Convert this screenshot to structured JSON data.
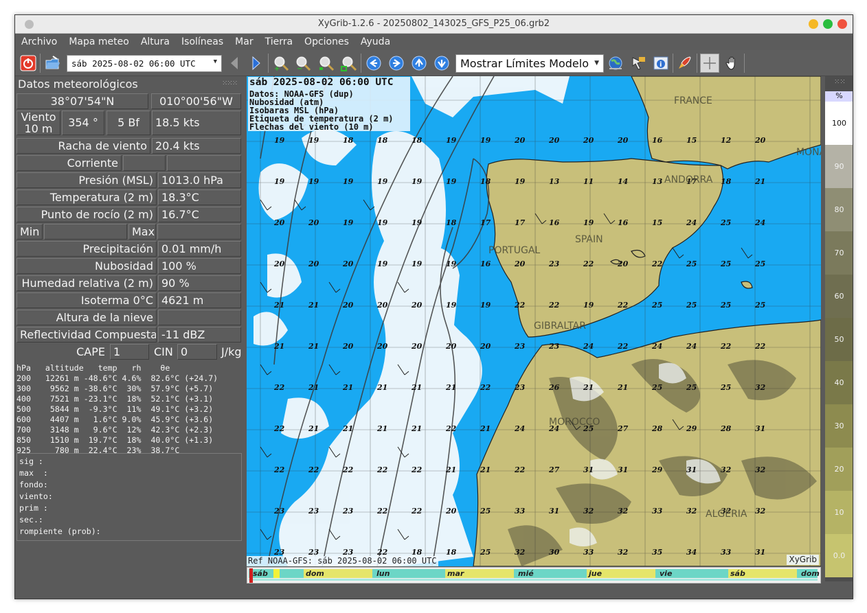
{
  "window": {
    "title": "XyGrib-1.2.6 - 20250802_143025_GFS_P25_06.grb2"
  },
  "menu": [
    "Archivo",
    "Mapa meteo",
    "Altura",
    "Isolíneas",
    "Mar",
    "Tierra",
    "Opciones",
    "Ayuda"
  ],
  "toolbar": {
    "date_value": "sáb 2025-08-02 06:00 UTC",
    "mode_value": "Mostrar Límites Modelo",
    "icons": [
      "power-icon",
      "open-file-icon",
      "prev-icon",
      "next-icon",
      "zoom-in-icon",
      "zoom-out-icon",
      "zoom-fit-icon",
      "zoom-all-icon",
      "left-icon",
      "right-icon",
      "up-icon",
      "down-icon",
      "globe-icon",
      "select-icon",
      "info-icon",
      "rocket-icon",
      "crosshair-icon",
      "hand-icon"
    ]
  },
  "panel": {
    "title": "Datos meteorológicos",
    "lat": "38°07'54\"N",
    "lon": "010°00'56\"W",
    "wind_label": "Viento\n10 m",
    "wind_dir": "354 °",
    "wind_bf": "5 Bf",
    "wind_speed": "18.5  kts",
    "rows": [
      {
        "label": "Racha de viento",
        "value": "20.4  kts"
      },
      {
        "label": "Corriente",
        "value": ""
      },
      {
        "label": "Presión (MSL)",
        "value": "1013.0 hPa"
      },
      {
        "label": "Temperatura (2 m)",
        "value": "18.3°C"
      },
      {
        "label": "Punto de rocío (2 m)",
        "value": "16.7°C"
      }
    ],
    "min_label": "Min",
    "max_label": "Max",
    "rows2": [
      {
        "label": "Precipitación",
        "value": "0.01 mm/h"
      },
      {
        "label": "Nubosidad",
        "value": "100 %"
      },
      {
        "label": "Humedad relativa (2 m)",
        "value": "90 %"
      },
      {
        "label": "Isoterma 0°C",
        "value": "4621 m"
      },
      {
        "label": "Altura de la nieve",
        "value": ""
      },
      {
        "label": "Reflectividad Compuesta",
        "value": "-11 dBZ"
      }
    ],
    "cape_label": "CAPE",
    "cape_value": "1",
    "cin_label": "CIN",
    "cin_value": "0",
    "cape_unit": "J/kg",
    "sounding": "hPa   altitude   temp   rh    θe\n200   12261 m -48.6°C 4.6%  82.6°C (+24.7)\n300    9562 m -38.6°C  30%  57.9°C (+5.7)\n400    7521 m -23.1°C  18%  52.1°C (+3.1)\n500    5844 m  -9.3°C  11%  49.1°C (+3.2)\n600    4407 m   1.6°C 9.0%  45.9°C (+3.6)\n700    3148 m   9.6°C  12%  42.3°C (+2.3)\n850    1510 m  19.7°C  18%  40.0°C (+1.3)\n925     780 m  22.4°C  23%  38.7°C",
    "waves": "sig :\nmax  :\nfondo:\nviento:\nprim :\nsec.:\nrompiente (prob):"
  },
  "map": {
    "legend_title": "sáb 2025-08-02 06:00 UTC",
    "legend_lines": [
      "Datos: NOAA-GFS (dup)",
      "Nubosidad (atm)",
      "Isobaras MSL (hPa)",
      "Etiqueta de temperatura (2 m)",
      "Flechas del viento (10 m)"
    ],
    "ref": "Ref NOAA-GFS: sáb 2025-08-02 06:00 UTC",
    "brand": "XyGrib",
    "place_labels": [
      "FRANCE",
      "MONA",
      "ANDORRA",
      "PORTUGAL",
      "SPAIN",
      "GIBRALTAR",
      "MOROCCO",
      "ALGERIA"
    ],
    "colors": {
      "sea": "#19a9f2",
      "land": "#c8bf7a",
      "cloud": "#f4f9fc"
    }
  },
  "timeline": {
    "days": [
      "sáb",
      "dom",
      "lun",
      "mar",
      "mié",
      "jue",
      "vie",
      "sáb",
      "dom"
    ]
  },
  "scale": {
    "unit": "%",
    "levels": [
      "100",
      "90",
      "80",
      "70",
      "60",
      "50",
      "40",
      "30",
      "20",
      "10",
      "0.0"
    ],
    "colors": [
      "#ffffff",
      "#b4b2a6",
      "#8f8e74",
      "#7b7a5c",
      "#6f6e50",
      "#6d6c48",
      "#7a7949",
      "#8d8b4f",
      "#a19f5a",
      "#b5b365",
      "#c6c46f"
    ]
  }
}
